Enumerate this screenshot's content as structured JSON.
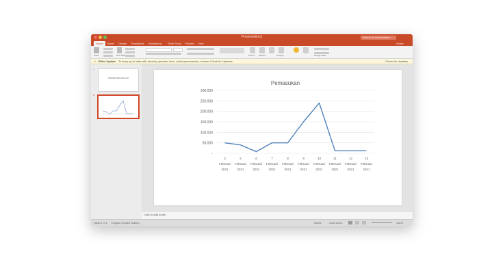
{
  "window": {
    "title": "Presentation1"
  },
  "search": {
    "placeholder": "Search in Presentation"
  },
  "tabs": [
    "Home",
    "Insert",
    "Design",
    "Transitions",
    "Animations",
    "Slide Show",
    "Review",
    "View"
  ],
  "share_label": "Share",
  "ribbon": {
    "paste": "Paste",
    "new_slide": "New Slide",
    "picture": "Picture",
    "shapes": "Shapes",
    "arrange": "Arrange",
    "design_ideas": "Design Ideas"
  },
  "infobar": {
    "title": "Office Update",
    "message": "To keep up-to-date with security updates, fixes, and improvements, choose Check for Updates.",
    "action": "Check for Updates"
  },
  "thumbnails": [
    {
      "number": "1",
      "title": "GRAFIK PENJUALAN"
    },
    {
      "number": "2"
    }
  ],
  "notes": {
    "placeholder": "Click to add notes"
  },
  "status": {
    "slide_counter": "Slide 2 of 2",
    "language": "English (United States)",
    "notes_btn": "Notes",
    "comments_btn": "Comments",
    "zoom": "118%"
  },
  "colors": {
    "accent": "#C84A28",
    "line": "#4F81BD"
  },
  "chart_data": {
    "type": "line",
    "title": "Pemasukan",
    "xlabel": "",
    "ylabel": "",
    "categories": [
      [
        "4",
        "Februari",
        "2021"
      ],
      [
        "5",
        "Februari",
        "2021"
      ],
      [
        "6",
        "Februari",
        "2021"
      ],
      [
        "7",
        "Februari",
        "2021"
      ],
      [
        "8",
        "Februari",
        "2021"
      ],
      [
        "9",
        "Februari",
        "2021"
      ],
      [
        "10",
        "Februari",
        "2021"
      ],
      [
        "11",
        "Februari",
        "2021"
      ],
      [
        "12",
        "Februari",
        "2021"
      ],
      [
        "13",
        "Februari",
        "2021"
      ]
    ],
    "series": [
      {
        "values": [
          50000,
          40000,
          8000,
          50000,
          50000,
          150000,
          240000,
          12000,
          12000,
          12000
        ]
      }
    ],
    "ylim": [
      0,
      300000
    ],
    "yticks": [
      "300.000",
      "250.000",
      "200.000",
      "150.000",
      "100.000",
      "50.000",
      "-"
    ],
    "grid": true,
    "legend": "none"
  }
}
